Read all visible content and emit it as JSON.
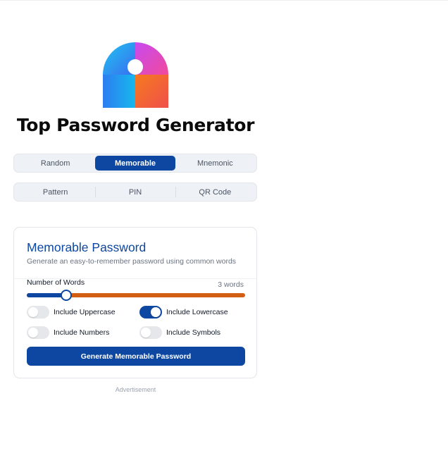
{
  "app": {
    "title": "Top Password Generator"
  },
  "tabs_row1": [
    {
      "label": "Random",
      "active": false
    },
    {
      "label": "Memorable",
      "active": true
    },
    {
      "label": "Mnemonic",
      "active": false
    }
  ],
  "tabs_row2": [
    {
      "label": "Pattern",
      "active": false
    },
    {
      "label": "PIN",
      "active": false
    },
    {
      "label": "QR Code",
      "active": false
    }
  ],
  "card": {
    "title": "Memorable Password",
    "description": "Generate an easy-to-remember password using common words",
    "words_label": "Number of Words",
    "words_value": "3 words",
    "slider_fraction": 0.18,
    "options": {
      "uppercase": {
        "label": "Include Uppercase",
        "on": false
      },
      "lowercase": {
        "label": "Include Lowercase",
        "on": true
      },
      "numbers": {
        "label": "Include Numbers",
        "on": false
      },
      "symbols": {
        "label": "Include Symbols",
        "on": false
      }
    },
    "generate_label": "Generate Memorable Password"
  },
  "ad_label": "Advertisement",
  "colors": {
    "primary": "#0d47a1",
    "slider_track": "#d35f14"
  },
  "icons": {
    "logo": "padlock-logo-icon"
  }
}
